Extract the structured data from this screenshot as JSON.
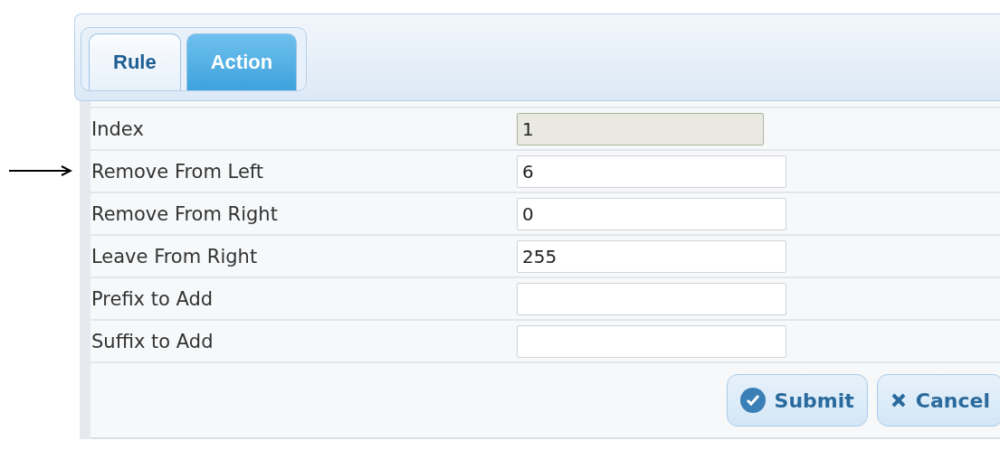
{
  "tabs": [
    {
      "label": "Rule",
      "selected": false
    },
    {
      "label": "Action",
      "selected": true
    }
  ],
  "rows": [
    {
      "label": "Index",
      "value": "1",
      "readonly": true,
      "pointer": false
    },
    {
      "label": "Remove From Left",
      "value": "6",
      "readonly": false,
      "pointer": true
    },
    {
      "label": "Remove From Right",
      "value": "0",
      "readonly": false,
      "pointer": false
    },
    {
      "label": "Leave From Right",
      "value": "255",
      "readonly": false,
      "pointer": false
    },
    {
      "label": "Prefix to Add",
      "value": "",
      "readonly": false,
      "pointer": false
    },
    {
      "label": "Suffix to Add",
      "value": "",
      "readonly": false,
      "pointer": false
    }
  ],
  "buttons": [
    {
      "kind": "submit",
      "label": "Submit"
    },
    {
      "kind": "cancel",
      "label": "Cancel"
    }
  ]
}
